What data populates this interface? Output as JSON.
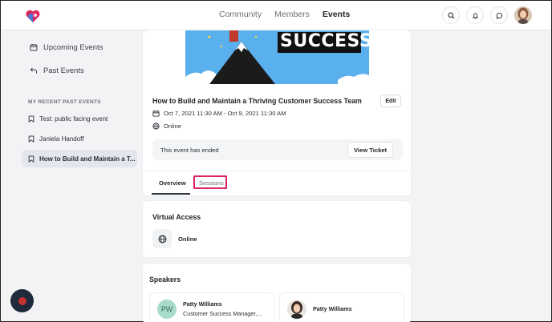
{
  "header": {
    "nav": [
      {
        "label": "Community",
        "active": false
      },
      {
        "label": "Members",
        "active": false
      },
      {
        "label": "Events",
        "active": true
      }
    ]
  },
  "sidebar": {
    "links": [
      {
        "label": "Upcoming Events",
        "icon": "calendar-icon"
      },
      {
        "label": "Past Events",
        "icon": "back-arrow-icon"
      }
    ],
    "recent_heading": "MY RECENT PAST EVENTS",
    "recent_items": [
      {
        "label": "Test: public facing event",
        "selected": false
      },
      {
        "label": "Janiela Handoff",
        "selected": false
      },
      {
        "label": "How to Build and Maintain a T...",
        "selected": true
      }
    ]
  },
  "event": {
    "banner_text": "SUCCESS",
    "title": "How to Build and Maintain a Thriving Customer Success Team",
    "edit_label": "Edit",
    "date_range": "Oct 7, 2021 11:30 AM - Oct 9, 2021 11:30 AM",
    "location": "Online",
    "ended_text": "This event has ended",
    "view_ticket_label": "View Ticket",
    "tabs": [
      {
        "label": "Overview",
        "active": true
      },
      {
        "label": "Sessions",
        "active": false
      }
    ]
  },
  "virtual_access": {
    "title": "Virtual Access",
    "value": "Online"
  },
  "speakers": {
    "title": "Speakers",
    "items": [
      {
        "initials": "PW",
        "name": "Patty Williams",
        "role": "Customer Success Manager,..."
      },
      {
        "name": "Patty Williams"
      }
    ]
  },
  "colors": {
    "highlight": "#e0245e",
    "banner_sky": "#5ab0ec",
    "avatar_green": "#a8dcc8"
  }
}
